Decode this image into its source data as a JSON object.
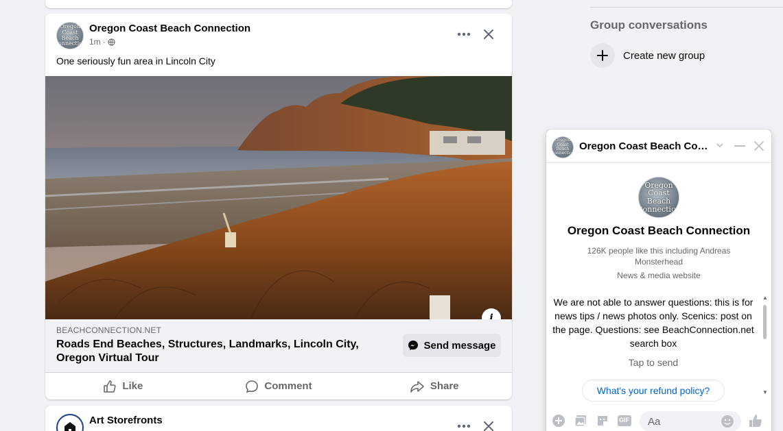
{
  "post": {
    "page_name": "Oregon Coast Beach Connection",
    "avatar_text": "Oregon Coast Beach Connection",
    "time": "1m",
    "separator": "·",
    "text": "One seriously fun area in Lincoln City",
    "link": {
      "domain": "BEACHCONNECTION.NET",
      "title": "Roads End Beaches, Structures, Landmarks, Lincoln City, Oregon Virtual Tour",
      "send_label": "Send message"
    },
    "actions": {
      "like": "Like",
      "comment": "Comment",
      "share": "Share"
    },
    "info_glyph": "i"
  },
  "next_post": {
    "page_name": "Art Storefronts"
  },
  "right_column": {
    "heading": "Group conversations",
    "create_group_label": "Create new group"
  },
  "chat": {
    "title": "Oregon Coast Beach Connection",
    "page_name": "Oregon Coast Beach Connection",
    "likes_text": "126K people like this including Andreas Monsterhead",
    "category": "News & media website",
    "greeting": "We are not able to answer questions: this is for news tips / news photos only. Scenics: post on the page. Questions: see BeachConnection.net search box",
    "tap_to_send": "Tap to send",
    "quick_reply": "What's your refund policy?",
    "composer_placeholder": "Aa",
    "gif_label": "GIF"
  },
  "colors": {
    "brand_blue": "#0064d1",
    "messenger_blue": "#0084ff",
    "background": "#f0f2f5",
    "secondary_text": "#65676b"
  },
  "icons": [
    "globe-icon",
    "more-icon",
    "close-icon",
    "info-icon",
    "messenger-icon",
    "like-icon",
    "comment-icon",
    "share-icon",
    "plus-icon",
    "chevron-down-icon",
    "minimize-icon",
    "add-icon",
    "image-icon",
    "sticker-icon",
    "gif-icon",
    "emoji-icon",
    "thumbs-up-icon"
  ]
}
